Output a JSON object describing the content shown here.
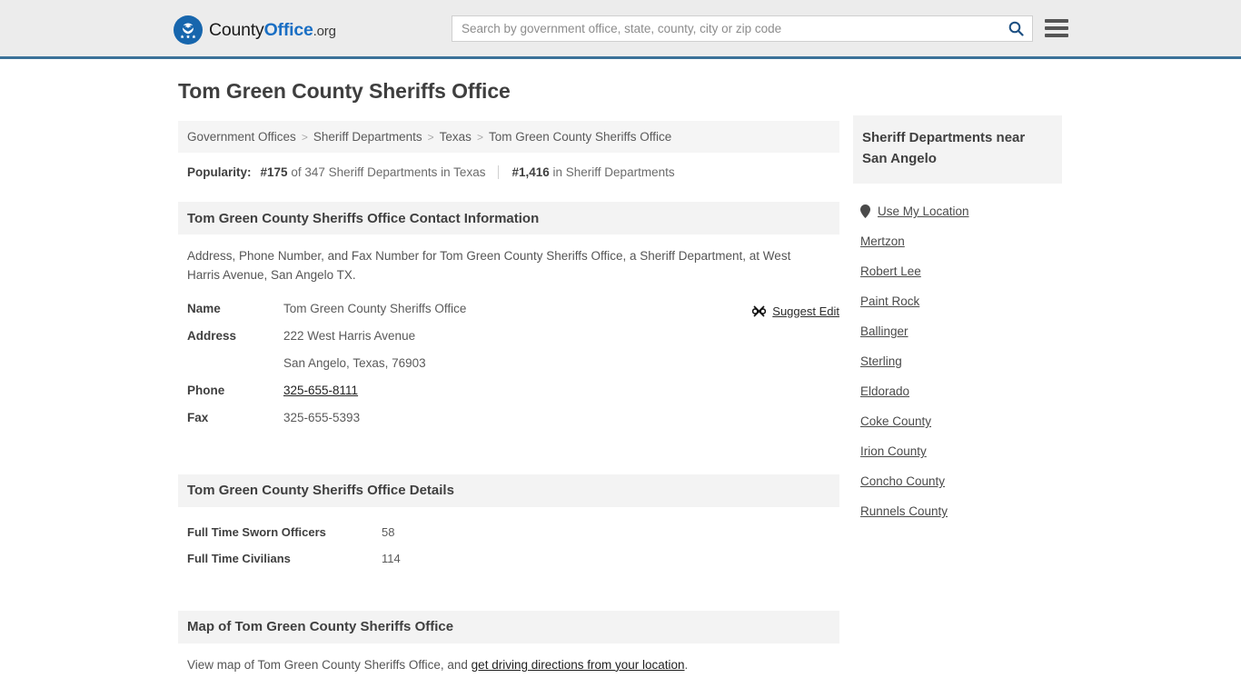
{
  "header": {
    "logo": {
      "icon": "eagle-seal-icon",
      "word1": "County",
      "word2": "Office",
      "suffix": ".org"
    },
    "search": {
      "placeholder": "Search by government office, state, county, city or zip code",
      "value": "",
      "search_icon": "search-icon"
    },
    "menu_icon": "hamburger-menu-icon",
    "accent_color": "#3b7299",
    "background_color": "#ececec"
  },
  "main": {
    "page_title": "Tom Green County Sheriffs Office",
    "breadcrumb": {
      "separator": ">",
      "items": [
        {
          "label": "Government Offices"
        },
        {
          "label": "Sheriff Departments"
        },
        {
          "label": "Texas"
        },
        {
          "label": "Tom Green County Sheriffs Office"
        }
      ]
    },
    "popularity": {
      "label": "Popularity:",
      "rank_state": "#175",
      "rank_state_suffix": "of 347 Sheriff Departments in Texas",
      "rank_national": "#1,416",
      "rank_national_suffix": "in Sheriff Departments"
    },
    "contact": {
      "heading": "Tom Green County Sheriffs Office Contact Information",
      "description": "Address, Phone Number, and Fax Number for Tom Green County Sheriffs Office, a Sheriff Department, at West Harris Avenue, San Angelo TX.",
      "suggest_edit": {
        "label": "Suggest Edit",
        "icon": "edit-suggest-icon"
      },
      "rows": [
        {
          "key": "Name",
          "value": "Tom Green County Sheriffs Office",
          "link": false
        },
        {
          "key": "Address",
          "value": "222 West Harris Avenue",
          "link": false
        },
        {
          "key": "",
          "value": "San Angelo, Texas, 76903",
          "link": false
        },
        {
          "key": "Phone",
          "value": "325-655-8111",
          "link": true
        },
        {
          "key": "Fax",
          "value": "325-655-5393",
          "link": false
        }
      ]
    },
    "details": {
      "heading": "Tom Green County Sheriffs Office Details",
      "rows": [
        {
          "key": "Full Time Sworn Officers",
          "value": "58"
        },
        {
          "key": "Full Time Civilians",
          "value": "114"
        }
      ]
    },
    "map": {
      "heading": "Map of Tom Green County Sheriffs Office",
      "description_pre": "View map of Tom Green County Sheriffs Office, and ",
      "link_label": "get driving directions from your location",
      "description_post": "."
    }
  },
  "sidebar": {
    "heading": "Sheriff Departments near San Angelo",
    "items": [
      {
        "label": "Use My Location",
        "icon": "map-pin-icon"
      },
      {
        "label": "Mertzon",
        "icon": ""
      },
      {
        "label": "Robert Lee",
        "icon": ""
      },
      {
        "label": "Paint Rock",
        "icon": ""
      },
      {
        "label": "Ballinger",
        "icon": ""
      },
      {
        "label": "Sterling",
        "icon": ""
      },
      {
        "label": "Eldorado",
        "icon": ""
      },
      {
        "label": "Coke County",
        "icon": ""
      },
      {
        "label": "Irion County",
        "icon": ""
      },
      {
        "label": "Concho County",
        "icon": ""
      },
      {
        "label": "Runnels County",
        "icon": ""
      }
    ]
  }
}
